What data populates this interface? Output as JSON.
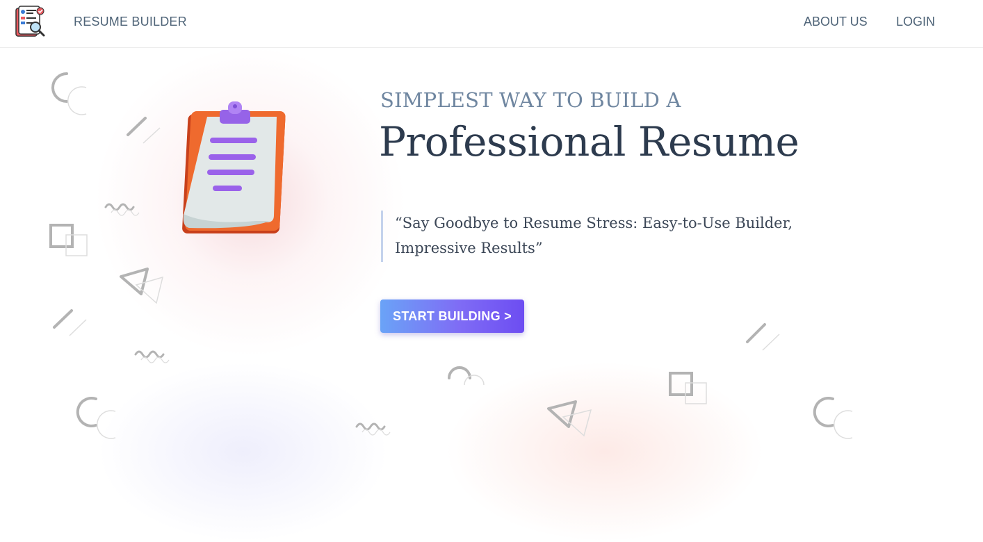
{
  "header": {
    "logo_icon": "resume-search-icon",
    "brand": "RESUME BUILDER",
    "nav": {
      "about": "ABOUT US",
      "login": "LOGIN"
    }
  },
  "hero": {
    "illustration_icon": "clipboard-icon",
    "tagline": "SIMPLEST WAY TO BUILD A",
    "headline": "Professional Resume",
    "quote": "“Say Goodbye to Resume Stress: Easy-to-Use Builder, Impressive Results”",
    "cta": "START BUILDING >"
  },
  "colors": {
    "text_muted": "#4f6478",
    "headline": "#2d3b4e",
    "cta_start": "#6aa3f7",
    "cta_end": "#6d4df2",
    "clipboard_orange": "#ef6a2e",
    "clip_purple": "#a36ef0"
  }
}
